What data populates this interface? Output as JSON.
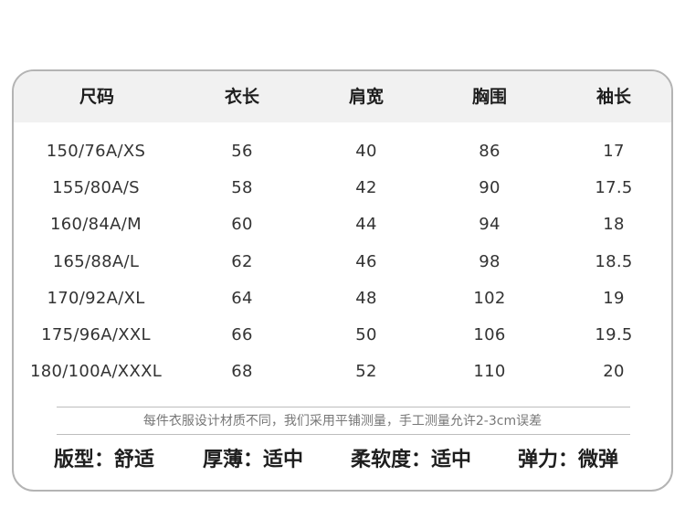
{
  "table": {
    "headers": [
      "尺码",
      "衣长",
      "肩宽",
      "胸围",
      "袖长"
    ],
    "rows": [
      [
        "150/76A/XS",
        "56",
        "40",
        "86",
        "17"
      ],
      [
        "155/80A/S",
        "58",
        "42",
        "90",
        "17.5"
      ],
      [
        "160/84A/M",
        "60",
        "44",
        "94",
        "18"
      ],
      [
        "165/88A/L",
        "62",
        "46",
        "98",
        "18.5"
      ],
      [
        "170/92A/XL",
        "64",
        "48",
        "102",
        "19"
      ],
      [
        "175/96A/XXL",
        "66",
        "50",
        "106",
        "19.5"
      ],
      [
        "180/100A/XXXL",
        "68",
        "52",
        "110",
        "20"
      ]
    ]
  },
  "note": "每件衣服设计材质不同，我们采用平铺测量，手工测量允许2-3cm误差",
  "features": [
    "版型：舒适",
    "厚薄：适中",
    "柔软度：适中",
    "弹力：微弹"
  ],
  "colors": {
    "border": "#b4b4b4",
    "header_bg": "#f1f1f1",
    "text": "#333333",
    "note_text": "#777777"
  }
}
